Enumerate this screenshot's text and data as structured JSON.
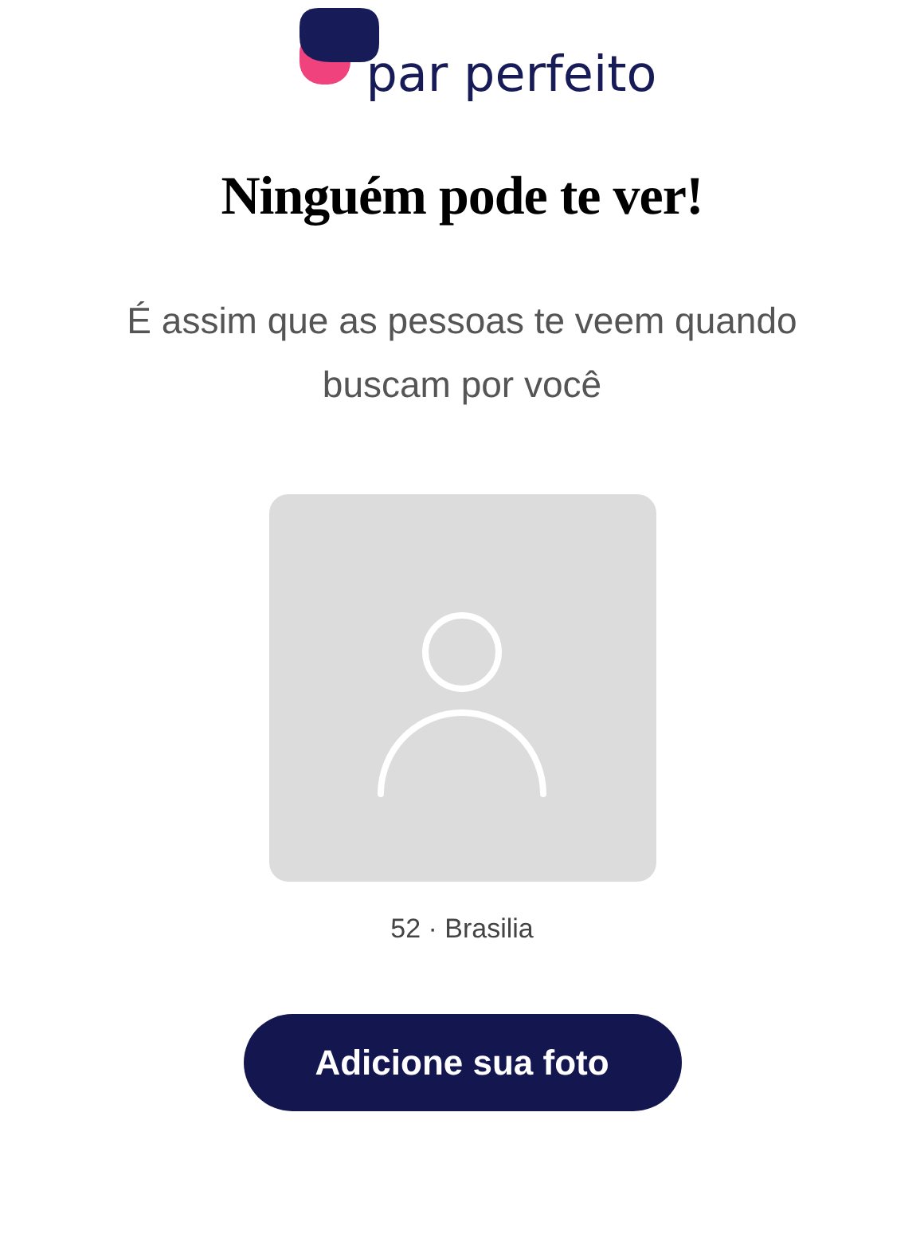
{
  "logo": {
    "text": "par perfeito"
  },
  "title": "Ninguém pode te ver!",
  "subtitle": "É assim que as pessoas te veem quando buscam por você",
  "profile": {
    "caption": "52 · Brasilia"
  },
  "button": {
    "label": "Adicione sua foto"
  }
}
